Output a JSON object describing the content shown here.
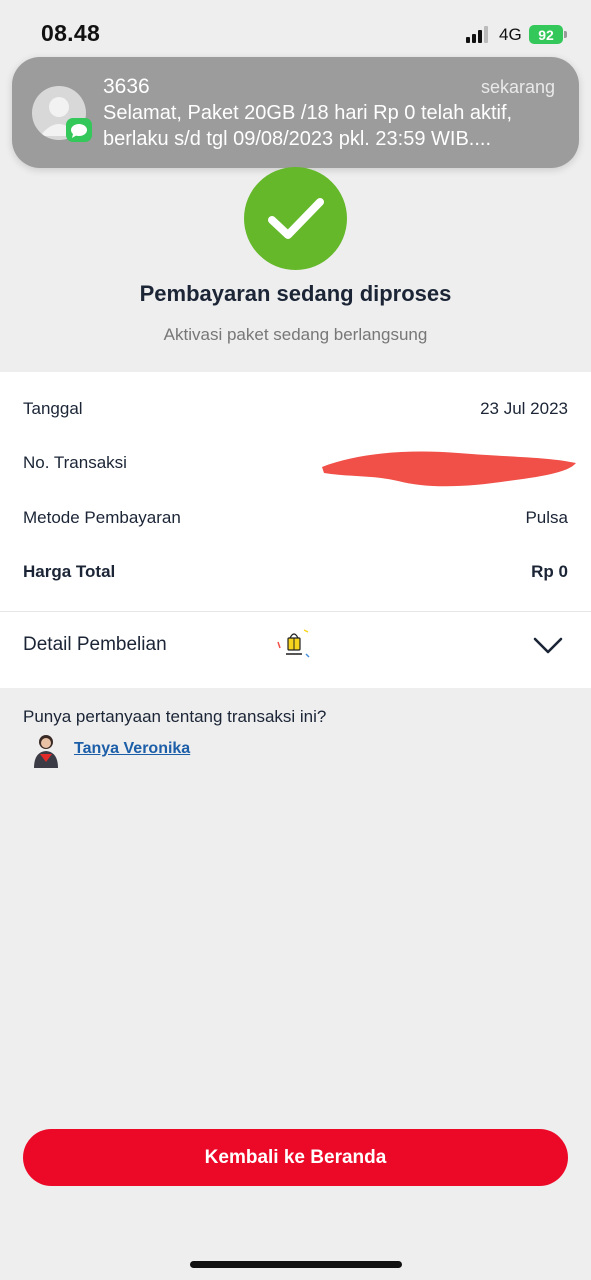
{
  "status_bar": {
    "time": "08.48",
    "network": "4G",
    "battery": "92"
  },
  "notification": {
    "sender": "3636",
    "time": "sekarang",
    "body": "Selamat, Paket 20GB /18 hari Rp 0 telah aktif,\nberlaku s/d tgl 09/08/2023 pkl. 23:59 WIB...."
  },
  "status": {
    "title": "Pembayaran sedang diproses",
    "subtitle": "Aktivasi paket sedang berlangsung"
  },
  "transaction": {
    "rows": [
      {
        "label": "Tanggal",
        "value": "23 Jul 2023"
      },
      {
        "label": "No. Transaksi",
        "value": ""
      },
      {
        "label": "Metode Pembayaran",
        "value": "Pulsa"
      },
      {
        "label": "Harga Total",
        "value": "Rp 0"
      }
    ]
  },
  "detail": {
    "label": "Detail Pembelian"
  },
  "help": {
    "question": "Punya pertanyaan tentang transaksi ini?",
    "link": "Tanya Veronika"
  },
  "footer": {
    "home_button": "Kembali ke Beranda"
  },
  "colors": {
    "accent_red": "#ec0928",
    "success_green": "#64b82a",
    "link_blue": "#1c5ea8"
  }
}
